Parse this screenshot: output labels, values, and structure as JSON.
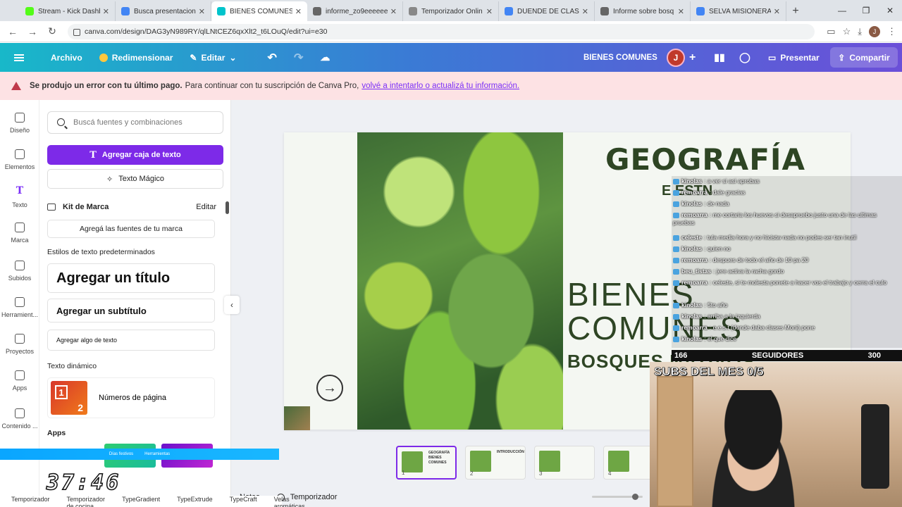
{
  "browser": {
    "tabs": [
      {
        "title": "Stream - Kick Dashb",
        "fav": "#53fc18"
      },
      {
        "title": "Busca presentacion",
        "fav": "#4285f4"
      },
      {
        "title": "BIENES COMUNES",
        "fav": "#00c4cc"
      },
      {
        "title": "informe_zo9eeeeeee",
        "fav": "#666666"
      },
      {
        "title": "Temporizador Onlin",
        "fav": "#888888"
      },
      {
        "title": "DUENDE DE CLASH",
        "fav": "#4285f4"
      },
      {
        "title": "Informe sobre bosq",
        "fav": "#666666"
      },
      {
        "title": "SELVA MISIONERA",
        "fav": "#4285f4"
      }
    ],
    "url": "canva.com/design/DAG3yN989RY/qlLNtCEZ6qxXlt2_t6LOuQ/edit?ui=e30",
    "profile_initial": "J"
  },
  "topbar": {
    "archivo": "Archivo",
    "redimensionar": "Redimensionar",
    "editar": "Editar",
    "doc_title": "BIENES COMUNES",
    "avatar": "J",
    "presentar": "Presentar",
    "compartir": "Compartir"
  },
  "banner": {
    "bold": "Se produjo un error con tu último pago.",
    "text": "Para continuar con tu suscripción de Canva Pro,",
    "link": "volvé a intentarlo o actualizá tu información."
  },
  "rail": [
    {
      "label": "Diseño"
    },
    {
      "label": "Elementos"
    },
    {
      "label": "Texto",
      "active": true
    },
    {
      "label": "Marca"
    },
    {
      "label": "Subidos"
    },
    {
      "label": "Herramient..."
    },
    {
      "label": "Proyectos"
    },
    {
      "label": "Apps"
    },
    {
      "label": "Contenido ..."
    }
  ],
  "panel": {
    "search_placeholder": "Buscá fuentes y combinaciones",
    "add_text_box": "Agregar caja de texto",
    "magic_text": "Texto Mágico",
    "brand_kit": "Kit de Marca",
    "brand_edit": "Editar",
    "brand_fonts": "Agregá las fuentes de tu marca",
    "default_styles": "Estilos de texto predeterminados",
    "add_title": "Agregar un título",
    "add_subtitle": "Agregar un subtítulo",
    "add_body": "Agregar algo de texto",
    "dynamic_text": "Texto dinámico",
    "page_numbers": "Números de página",
    "apps": "Apps"
  },
  "slide": {
    "title": "GEOGRAFÍA",
    "subtitle": "E ESTN",
    "heading_line1": "BIENES",
    "heading_line2": "COMUNES",
    "subheading": "BOSQUES NATIVOS",
    "arrow": "→"
  },
  "thumbnails": [
    {
      "num": "1",
      "text": "GEOGRAFÍA BIENES COMUNES",
      "active": true
    },
    {
      "num": "2",
      "text": "INTRODUCCIÓN"
    },
    {
      "num": "3",
      "text": ""
    },
    {
      "num": "4",
      "text": ""
    }
  ],
  "bottom": {
    "notes": "Notas",
    "timer": "Temporizador"
  },
  "overlay": {
    "timer_display": "37:46",
    "bottom_labels": [
      "Temporizador",
      "Temporizador de cocina",
      "TypeGradient",
      "TypeExtrude",
      "TypeCraft",
      "Velas aromáticas"
    ],
    "bar_items": [
      "Días festivos",
      "Herramientas"
    ]
  },
  "chat": {
    "messages": [
      {
        "user": "kinolas",
        "text": ": a ver si asi aprobas"
      },
      {
        "user": "remoarra",
        "text": ": dale gracias"
      },
      {
        "user": "kinolas",
        "text": ": de nada"
      },
      {
        "user": "remoarra",
        "text": ": me cortaria los huevos si desapruebo justo una de las ultimas pruebas"
      },
      {
        "user": "celeste",
        "text": ": tula media hora y no hicistw nada no podes ser tan inutil"
      },
      {
        "user": "kinolas",
        "text": ": quien no"
      },
      {
        "user": "remoarra",
        "text": ": despues de todo el año de 10 pa 20"
      },
      {
        "user": "beu_tistas",
        "text": ": jere activa la racha gordo"
      },
      {
        "user": "remoarra",
        "text": ": celeste, si te molesta ponete a hacer vos el trabajo y cerra el culo"
      },
      {
        "user": "kinolas",
        "text": ": 5to año"
      },
      {
        "user": "kinolas",
        "text": ": arriba a la izquierda"
      },
      {
        "user": "remoarra",
        "text": ": e.e.s.t (donde daba clases Moni) pone"
      },
      {
        "user": "kinolas",
        "text": ": el que dice"
      }
    ],
    "followers_current": "166",
    "followers_label": "SEGUIDORES",
    "followers_goal": "300",
    "subs_text": "SUBS DEL MES 0/5"
  }
}
